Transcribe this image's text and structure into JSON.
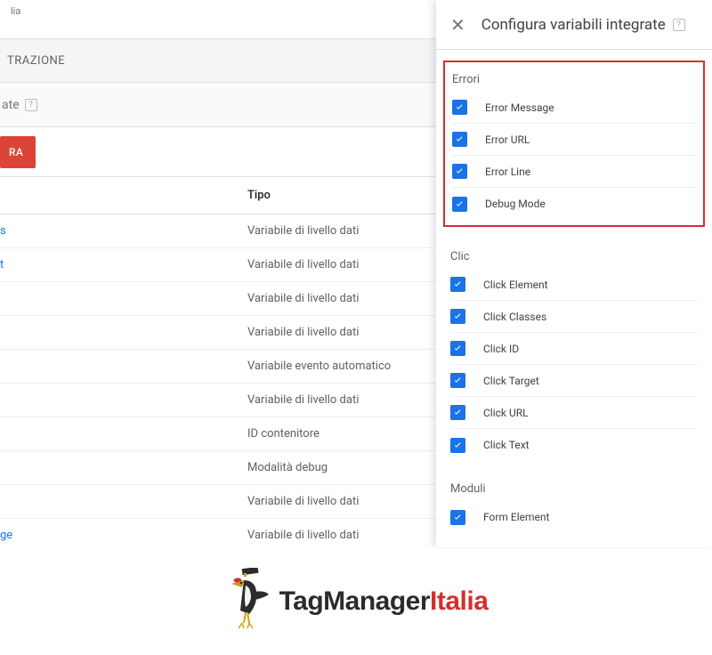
{
  "header": {
    "workspace_suffix": "lia",
    "tab_label": "TRAZIONE",
    "subheader_suffix": "ate",
    "config_button_suffix": "RA"
  },
  "table": {
    "header_type": "Tipo",
    "rows": [
      {
        "name_suffix": "s",
        "type": "Variabile di livello dati"
      },
      {
        "name_suffix": "t",
        "type": "Variabile di livello dati"
      },
      {
        "name_suffix": "",
        "type": "Variabile di livello dati"
      },
      {
        "name_suffix": "",
        "type": "Variabile di livello dati"
      },
      {
        "name_suffix": "",
        "type": "Variabile evento automatico"
      },
      {
        "name_suffix": "",
        "type": "Variabile di livello dati"
      },
      {
        "name_suffix": "",
        "type": "ID contenitore"
      },
      {
        "name_suffix": "",
        "type": "Modalità debug"
      },
      {
        "name_suffix": "",
        "type": "Variabile di livello dati"
      },
      {
        "name_suffix": "ge",
        "type": "Variabile di livello dati"
      }
    ]
  },
  "panel": {
    "title": "Configura variabili integrate",
    "sections": [
      {
        "title": "Errori",
        "highlighted": true,
        "items": [
          {
            "label": "Error Message",
            "checked": true
          },
          {
            "label": "Error URL",
            "checked": true
          },
          {
            "label": "Error Line",
            "checked": true
          },
          {
            "label": "Debug Mode",
            "checked": true
          }
        ]
      },
      {
        "title": "Clic",
        "highlighted": false,
        "items": [
          {
            "label": "Click Element",
            "checked": true
          },
          {
            "label": "Click Classes",
            "checked": true
          },
          {
            "label": "Click ID",
            "checked": true
          },
          {
            "label": "Click Target",
            "checked": true
          },
          {
            "label": "Click URL",
            "checked": true
          },
          {
            "label": "Click Text",
            "checked": true
          }
        ]
      },
      {
        "title": "Moduli",
        "highlighted": false,
        "items": [
          {
            "label": "Form Element",
            "checked": true
          }
        ]
      }
    ]
  },
  "branding": {
    "text1": "TagManager",
    "text2": "Italia"
  }
}
